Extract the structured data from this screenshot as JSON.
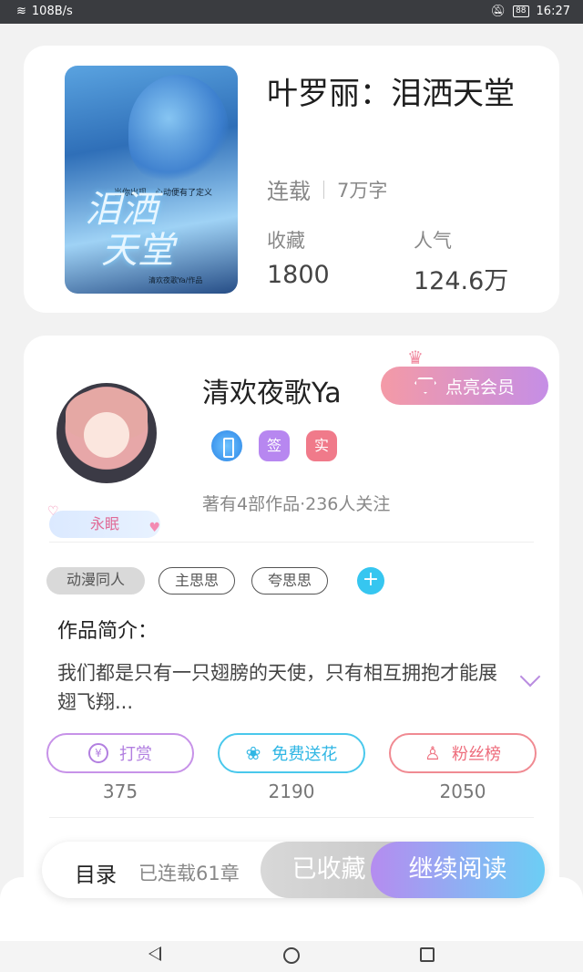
{
  "status_bar": {
    "speed": "108B/s",
    "battery": "88",
    "time": "16:27"
  },
  "book": {
    "title": "叶罗丽：泪洒天堂",
    "status": "连载",
    "word_count": "7万字",
    "favorites_label": "收藏",
    "favorites_value": "1800",
    "popularity_label": "人气",
    "popularity_value": "124.6万",
    "cover": {
      "title_line1": "泪洒",
      "title_line2": "天堂",
      "tagline": "当你出现，心动便有了定义",
      "author_credit": "清欢夜歌Ya/作品"
    }
  },
  "author": {
    "name": "清欢夜歌Ya",
    "vip_label": "点亮会员",
    "badges": {
      "sign": "签",
      "real": "实"
    },
    "title_badge": "永眠",
    "works_summary": "著有4部作品·236人关注"
  },
  "tags": {
    "category": "动漫同人",
    "tag1": "主思思",
    "tag2": "夸思思",
    "add": "+"
  },
  "intro": {
    "heading": "作品简介：",
    "text": "我们都是只有一只翅膀的天使，只有相互拥抱才能展翅飞翔..."
  },
  "actions": {
    "reward_label": "打赏",
    "reward_count": "375",
    "flower_label": "免费送花",
    "flower_count": "2190",
    "fans_label": "粉丝榜",
    "fans_count": "2050"
  },
  "bottom_bar": {
    "catalog": "目录",
    "chapters": "已连载61章",
    "collected": "已收藏",
    "continue": "继续阅读"
  },
  "colors": {
    "accent_purple": "#b58cf0",
    "accent_blue": "#6ccef5",
    "vip_pink": "#f49aa6"
  }
}
